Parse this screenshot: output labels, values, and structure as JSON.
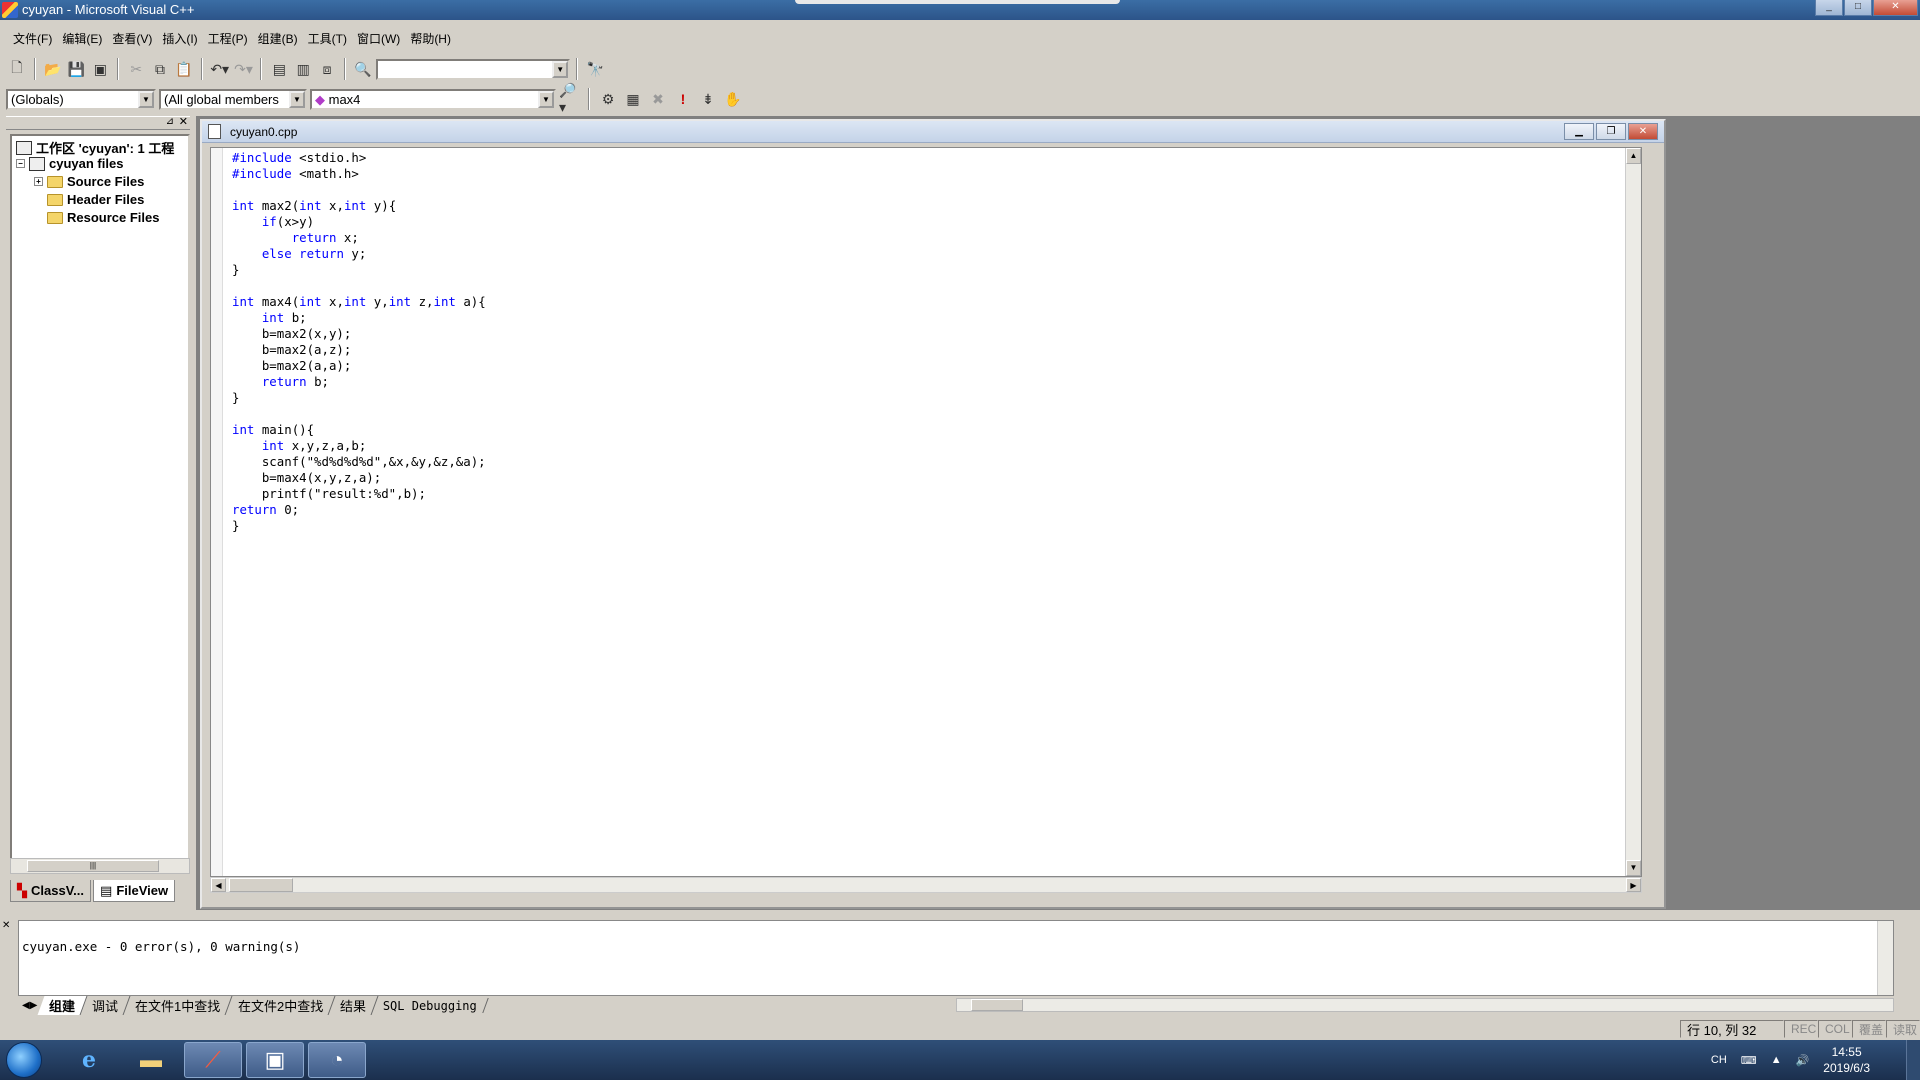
{
  "window": {
    "title": "cyuyan - Microsoft Visual C++",
    "buttons": [
      "_",
      "□",
      "✕"
    ]
  },
  "menubar": [
    "文件(F)",
    "编辑(E)",
    "查看(V)",
    "插入(I)",
    "工程(P)",
    "组建(B)",
    "工具(T)",
    "窗口(W)",
    "帮助(H)"
  ],
  "toolbar2": {
    "scope_combo": "(Globals)",
    "members_combo": "(All global members",
    "function_combo": "max4"
  },
  "workspace": {
    "root": "工作区 'cyuyan': 1 工程",
    "project": "cyuyan files",
    "folders": [
      "Source Files",
      "Header Files",
      "Resource Files"
    ],
    "tabs": [
      "ClassV...",
      "FileView"
    ]
  },
  "editor": {
    "filename": "cyuyan0.cpp",
    "lines": [
      "#include <stdio.h>",
      "#include <math.h>",
      "",
      "int max2(int x,int y){",
      "    if(x>y)",
      "        return x;",
      "    else return y;",
      "}",
      "",
      "int max4(int x,int y,int z,int a){",
      "    int b;",
      "    b=max2(x,y);",
      "    b=max2(a,z);",
      "    b=max2(a,a);",
      "    return b;",
      "}",
      "",
      "int main(){",
      "    int x,y,z,a,b;",
      "    scanf(\"%d%d%d%d\",&x,&y,&z,&a);",
      "    b=max4(x,y,z,a);",
      "    printf(\"result:%d\",b);",
      "return 0;",
      "}"
    ],
    "keywords": [
      "#include",
      "int",
      "if",
      "return",
      "else"
    ]
  },
  "output": {
    "text": "cyuyan.exe - 0 error(s), 0 warning(s)",
    "tabs": [
      "组建",
      "调试",
      "在文件1中查找",
      "在文件2中查找",
      "结果",
      "SQL Debugging"
    ]
  },
  "statusbar": {
    "position": "行 10, 列 32",
    "indicators": [
      "REC",
      "COL",
      "覆盖",
      "读取"
    ]
  },
  "taskbar": {
    "tray_lang": "CH",
    "time": "14:55",
    "date": "2019/6/3"
  }
}
